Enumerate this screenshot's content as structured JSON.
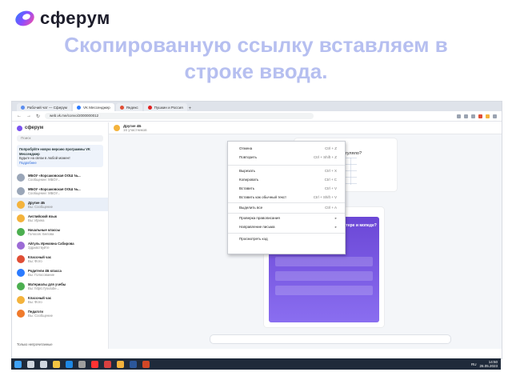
{
  "brand": {
    "name": "сферум"
  },
  "heading": {
    "line1": "Скопированную ссылку вставляем в",
    "line2": "строке ввода."
  },
  "browser": {
    "tabs": [
      {
        "label": "Рабочий чат — Сферум",
        "color": "#5b8def"
      },
      {
        "label": "VK Мессенджер",
        "color": "#2b7bff"
      },
      {
        "label": "",
        "color": "#e04e35"
      },
      {
        "label": "Яндекс",
        "color": "#ff3333"
      },
      {
        "label": "Пушкин и Россия",
        "color": "#e02020"
      }
    ],
    "url": "web.vk.me/convo/2000000012"
  },
  "sidebar": {
    "logo": "сферум",
    "search_placeholder": "Поиск",
    "promo": {
      "title": "Попробуйте новую версию программы VK Мессенджер",
      "text": "Будьте на связи в любой момент",
      "link": "Подробнее"
    },
    "chats": [
      {
        "name": "МБОУ «Корсаковская ООШ №...",
        "msg": "Сообщение: МБОУ...",
        "color": "#9aa6b8"
      },
      {
        "name": "МБОУ «Корсаковская ООШ №...",
        "msg": "Сообщение: МБОУ...",
        "color": "#9aa6b8"
      },
      {
        "name": "Другие 4Б",
        "msg": "Вы: Сообщение",
        "color": "#f4b33c",
        "selected": true
      },
      {
        "name": "Английский язык",
        "msg": "Вы: Ирина",
        "color": "#f4b33c"
      },
      {
        "name": "Начальные классы",
        "msg": "Голосов: Белова",
        "color": "#4caf50"
      },
      {
        "name": "Айгуль Ирековна Сабирова",
        "msg": "Здравствуйте",
        "color": "#9c6bd6"
      },
      {
        "name": "Классный час",
        "msg": "Вы: Фото",
        "color": "#e04e35"
      },
      {
        "name": "Родители 4Б класса",
        "msg": "Вы: Голосование",
        "color": "#2b7bff"
      },
      {
        "name": "Материалы для учебы",
        "msg": "Вы: https://youtube...",
        "color": "#4caf50"
      },
      {
        "name": "Классный час",
        "msg": "Вы: Фото",
        "color": "#f4b33c"
      },
      {
        "name": "Педагоги",
        "msg": "Вы: Сообщение",
        "color": "#f07a2b"
      }
    ],
    "footer": "Только непрочитанные"
  },
  "chat": {
    "title": "Другие 4Б",
    "subtitle": "16 участников",
    "video_question": "Что прогуляло?",
    "poll_title": "Со скольких лет можно ездить на скутере и мопеде?",
    "input_placeholder": "Сообщение"
  },
  "context_menu": {
    "items": [
      {
        "label": "Отмена",
        "key": "Ctrl + Z"
      },
      {
        "label": "Повторить",
        "key": "Ctrl + Shift + Z"
      },
      {
        "label": "Вырезать",
        "key": "Ctrl + X"
      },
      {
        "label": "Копировать",
        "key": "Ctrl + C"
      },
      {
        "label": "Вставить",
        "key": "Ctrl + V"
      },
      {
        "label": "Вставить как обычный текст",
        "key": "Ctrl + Shift + V"
      },
      {
        "label": "Выделить все",
        "key": "Ctrl + A"
      },
      {
        "label": "Проверка правописания",
        "key": "▸"
      },
      {
        "label": "Направление письма",
        "key": "▸"
      },
      {
        "label": "Просмотреть код",
        "key": ""
      }
    ]
  },
  "taskbar": {
    "lang": "RU",
    "time": "14:50",
    "date": "26.05.2023"
  }
}
